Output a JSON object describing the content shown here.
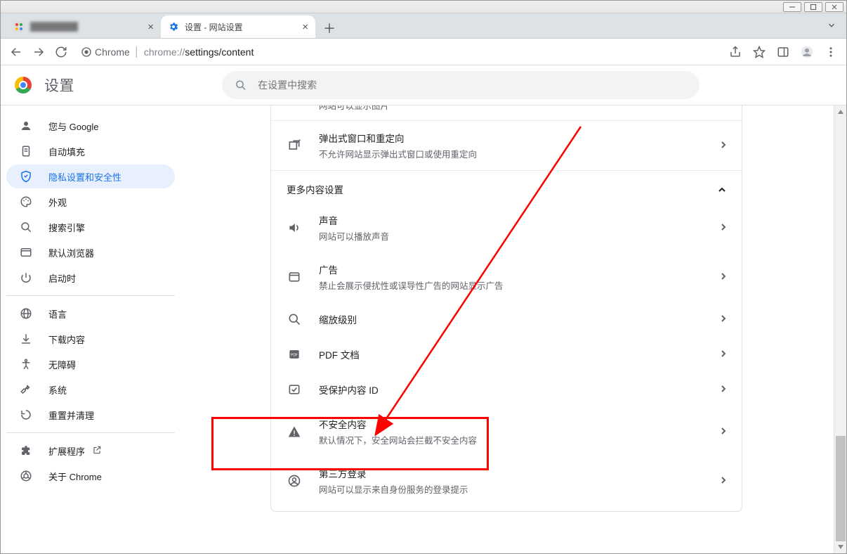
{
  "window_controls": {
    "minimize": "—",
    "maximize": "▢",
    "close": "✕"
  },
  "tabs": [
    {
      "title": "████████",
      "active": false
    },
    {
      "title": "设置 - 网站设置",
      "active": true
    }
  ],
  "omnibox": {
    "label": "Chrome",
    "url_gray": "chrome://",
    "url_dark": "settings/content"
  },
  "settings_header": {
    "title": "设置",
    "search_placeholder": "在设置中搜索"
  },
  "sidebar": {
    "items": [
      {
        "icon": "person",
        "label": "您与 Google"
      },
      {
        "icon": "autofill",
        "label": "自动填充"
      },
      {
        "icon": "shield",
        "label": "隐私设置和安全性",
        "active": true
      },
      {
        "icon": "palette",
        "label": "外观"
      },
      {
        "icon": "search",
        "label": "搜索引擎"
      },
      {
        "icon": "browser",
        "label": "默认浏览器"
      },
      {
        "icon": "power",
        "label": "启动时"
      }
    ],
    "items2": [
      {
        "icon": "globe",
        "label": "语言"
      },
      {
        "icon": "download",
        "label": "下载内容"
      },
      {
        "icon": "accessibility",
        "label": "无障碍"
      },
      {
        "icon": "wrench",
        "label": "系统"
      },
      {
        "icon": "reset",
        "label": "重置并清理"
      }
    ],
    "items3": [
      {
        "icon": "extension",
        "label": "扩展程序",
        "external": true
      },
      {
        "icon": "chrome",
        "label": "关于 Chrome"
      }
    ]
  },
  "content": {
    "top_partial": {
      "sub": "网站可以显示图片"
    },
    "popups": {
      "title": "弹出式窗口和重定向",
      "sub": "不允许网站显示弹出式窗口或使用重定向"
    },
    "section_more": "更多内容设置",
    "sound": {
      "title": "声音",
      "sub": "网站可以播放声音"
    },
    "ads": {
      "title": "广告",
      "sub": "禁止会展示侵扰性或误导性广告的网站显示广告"
    },
    "zoom": {
      "title": "缩放级别"
    },
    "pdf": {
      "title": "PDF 文档"
    },
    "protected": {
      "title": "受保护内容 ID"
    },
    "insecure": {
      "title": "不安全内容",
      "sub": "默认情况下，安全网站会拦截不安全内容"
    },
    "thirdparty": {
      "title": "第三方登录",
      "sub": "网站可以显示来自身份服务的登录提示"
    }
  }
}
